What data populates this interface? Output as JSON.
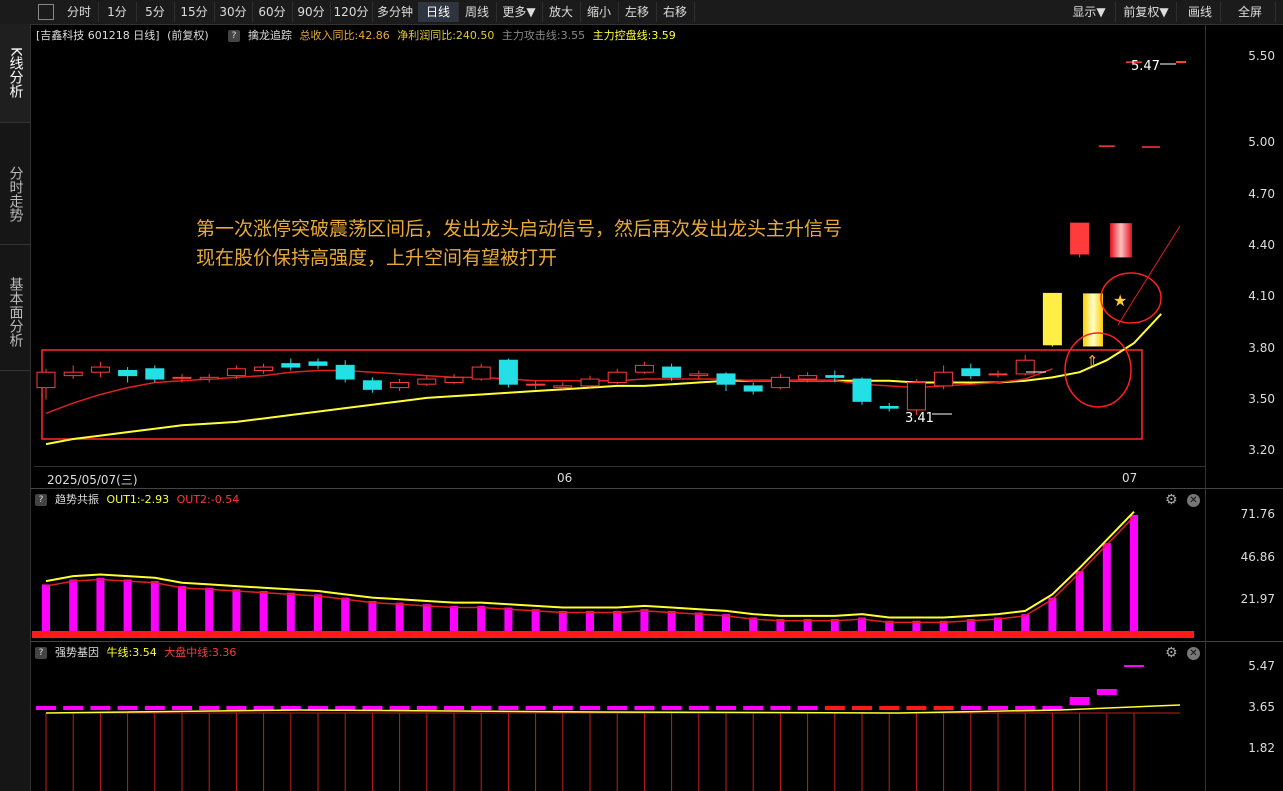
{
  "toolbar": {
    "buttons": [
      "分时",
      "1分",
      "5分",
      "15分",
      "30分",
      "60分",
      "90分",
      "120分",
      "多分钟",
      "日线",
      "周线",
      "更多▼",
      "放大",
      "缩小",
      "左移",
      "右移"
    ],
    "active": "日线",
    "right_buttons": [
      "显示▼",
      "前复权▼",
      "画线",
      "全屏"
    ]
  },
  "sidebar": {
    "tabs": [
      "K线分析",
      "分时走势",
      "基本面分析"
    ]
  },
  "main_info": {
    "stock": "[吉鑫科技 601218 日线]",
    "adjust": "(前复权)",
    "indicator": "擒龙追踪",
    "revenue": "总收入同比:42.86",
    "profit": "净利润同比:240.50",
    "attack": "主力攻击线:3.55",
    "control": "主力控盘线:3.59"
  },
  "annotation": {
    "line1": "第一次涨停突破震荡区间后，发出龙头启动信号，然后再次发出龙头主升信号",
    "line2": "现在股价保持高强度，上升空间有望被打开"
  },
  "price_axis": [
    "5.50",
    "5.00",
    "4.70",
    "4.40",
    "4.10",
    "3.80",
    "3.50",
    "3.20"
  ],
  "price_marks": {
    "high": "5.47",
    "low": "3.41"
  },
  "date_axis": {
    "start": "2025/05/07(三)",
    "m06": "06",
    "m07": "07"
  },
  "panel2": {
    "name": "趋势共振",
    "out1": "OUT1:-2.93",
    "out2": "OUT2:-0.54",
    "axis": [
      "71.76",
      "46.86",
      "21.97"
    ]
  },
  "panel3": {
    "name": "强势基因",
    "bull": "牛线:3.54",
    "market": "大盘中线:3.36",
    "axis": [
      "5.47",
      "3.65",
      "1.82"
    ]
  },
  "colors": {
    "up": "#ff3b3b",
    "down": "#22e0e6",
    "yellow": "#ffff33",
    "magenta": "#ff00ff",
    "orange": "#e6a93a"
  },
  "chart_data": {
    "type": "candlestick",
    "price_range": [
      3.2,
      5.5
    ],
    "candles": [
      [
        3.57,
        3.66,
        3.68,
        3.5
      ],
      [
        3.64,
        3.66,
        3.7,
        3.62
      ],
      [
        3.66,
        3.69,
        3.72,
        3.63
      ],
      [
        3.67,
        3.64,
        3.69,
        3.6
      ],
      [
        3.68,
        3.62,
        3.7,
        3.6
      ],
      [
        3.63,
        3.63,
        3.65,
        3.6
      ],
      [
        3.62,
        3.63,
        3.65,
        3.6
      ],
      [
        3.64,
        3.68,
        3.7,
        3.62
      ],
      [
        3.67,
        3.69,
        3.71,
        3.65
      ],
      [
        3.71,
        3.69,
        3.74,
        3.67
      ],
      [
        3.72,
        3.7,
        3.74,
        3.68
      ],
      [
        3.7,
        3.62,
        3.73,
        3.6
      ],
      [
        3.61,
        3.56,
        3.63,
        3.54
      ],
      [
        3.57,
        3.6,
        3.62,
        3.55
      ],
      [
        3.59,
        3.62,
        3.64,
        3.58
      ],
      [
        3.6,
        3.63,
        3.65,
        3.59
      ],
      [
        3.62,
        3.69,
        3.71,
        3.61
      ],
      [
        3.73,
        3.59,
        3.74,
        3.57
      ],
      [
        3.59,
        3.59,
        3.61,
        3.56
      ],
      [
        3.57,
        3.58,
        3.6,
        3.56
      ],
      [
        3.58,
        3.62,
        3.64,
        3.57
      ],
      [
        3.6,
        3.66,
        3.68,
        3.59
      ],
      [
        3.66,
        3.7,
        3.72,
        3.65
      ],
      [
        3.69,
        3.63,
        3.71,
        3.61
      ],
      [
        3.64,
        3.65,
        3.67,
        3.62
      ],
      [
        3.65,
        3.59,
        3.66,
        3.55
      ],
      [
        3.58,
        3.55,
        3.6,
        3.53
      ],
      [
        3.57,
        3.63,
        3.65,
        3.56
      ],
      [
        3.62,
        3.64,
        3.66,
        3.6
      ],
      [
        3.64,
        3.63,
        3.67,
        3.6
      ],
      [
        3.62,
        3.49,
        3.63,
        3.47
      ],
      [
        3.46,
        3.45,
        3.48,
        3.43
      ],
      [
        3.44,
        3.6,
        3.62,
        3.41
      ],
      [
        3.58,
        3.66,
        3.7,
        3.56
      ],
      [
        3.68,
        3.64,
        3.71,
        3.62
      ],
      [
        3.65,
        3.65,
        3.67,
        3.63
      ],
      [
        3.65,
        3.73,
        3.76,
        3.64
      ],
      [
        3.82,
        4.12,
        4.12,
        3.81
      ],
      [
        4.35,
        4.53,
        4.53,
        4.33
      ],
      [
        4.98,
        4.98,
        4.98,
        4.98
      ],
      [
        5.47,
        5.47,
        5.47,
        5.47
      ]
    ],
    "attack_line": [
      3.42,
      3.48,
      3.53,
      3.57,
      3.6,
      3.61,
      3.62,
      3.63,
      3.64,
      3.66,
      3.67,
      3.67,
      3.66,
      3.65,
      3.64,
      3.63,
      3.63,
      3.62,
      3.61,
      3.61,
      3.61,
      3.61,
      3.62,
      3.62,
      3.62,
      3.62,
      3.61,
      3.61,
      3.61,
      3.61,
      3.59,
      3.58,
      3.57,
      3.58,
      3.59,
      3.6,
      3.62,
      3.68
    ],
    "control_line": [
      3.24,
      3.27,
      3.29,
      3.31,
      3.33,
      3.35,
      3.36,
      3.37,
      3.39,
      3.41,
      3.43,
      3.45,
      3.47,
      3.49,
      3.51,
      3.52,
      3.53,
      3.54,
      3.55,
      3.56,
      3.57,
      3.58,
      3.58,
      3.59,
      3.6,
      3.61,
      3.61,
      3.61,
      3.61,
      3.61,
      3.61,
      3.61,
      3.6,
      3.6,
      3.6,
      3.6,
      3.61,
      3.63,
      3.66,
      3.73,
      3.83,
      4.0
    ],
    "trend_bars": [
      30,
      33,
      34,
      33,
      32,
      29,
      28,
      27,
      26,
      25,
      24,
      22,
      20,
      19,
      18,
      17,
      17,
      16,
      15,
      14,
      14,
      14,
      15,
      14,
      13,
      12,
      10,
      9,
      9,
      9,
      10,
      8,
      8,
      8,
      9,
      10,
      12,
      22,
      38,
      55,
      72
    ],
    "trend_range": [
      0,
      75
    ]
  }
}
